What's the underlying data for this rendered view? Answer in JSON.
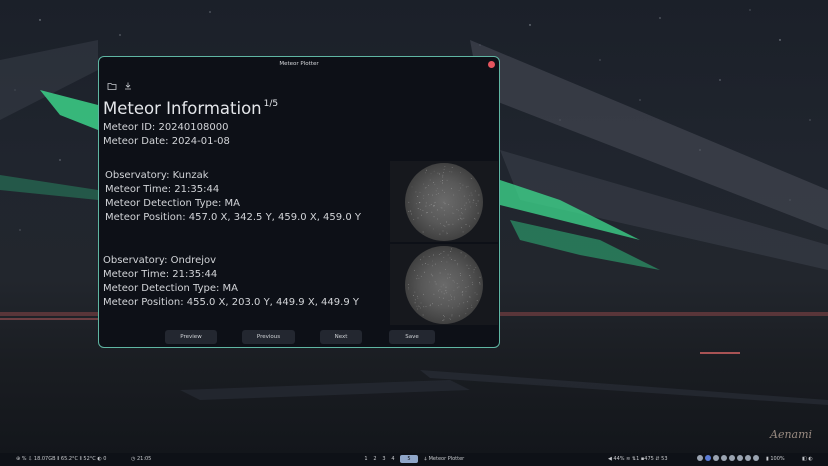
{
  "window": {
    "title": "Meteor Plotter",
    "heading": "Meteor Information",
    "page_indicator": "1/5",
    "meteor_id": "Meteor ID: 20240108000",
    "meteor_date": "Meteor Date: 2024-01-08"
  },
  "observations": [
    {
      "observatory": "Observatory: Kunzak",
      "time": "Meteor Time: 21:35:44",
      "detection_type": "Meteor Detection Type: MA",
      "position": "Meteor Position: 457.0 X, 342.5 Y, 459.0 X, 459.0 Y"
    },
    {
      "observatory": "Observatory: Ondrejov",
      "time": "Meteor Time: 21:35:44",
      "detection_type": "Meteor Detection Type: MA",
      "position": "Meteor Position: 455.0 X, 203.0 Y, 449.9 X, 449.9 Y"
    }
  ],
  "buttons": {
    "preview": "Preview Meteor",
    "previous": "Previous Meteor",
    "next": "Next Meteor",
    "save": "Save Meteors"
  },
  "toolbar": {
    "open_icon": "folder-icon",
    "save_icon": "download-icon"
  },
  "taskbar": {
    "system_stats": "⊕ % ⇩ 18.07GB  ⦀ 65.2°C  ⦀ 52°C  ◐ 0",
    "clock": "◷ 21:05",
    "workspaces": [
      "1",
      "2",
      "3",
      "4",
      "5"
    ],
    "active_workspace": "5",
    "active_app": "⍋ Meteor Plotter",
    "network": "◀ 44%  ≋ ⇅1  ▪475  ⇵ 53",
    "battery": "▮ 100%",
    "end": "◧ ◐"
  },
  "wallpaper": {
    "signature": "Aenami"
  },
  "colors": {
    "window_border": "#5fb6a3",
    "window_bg": "#0d1017",
    "close_button": "#e4555e",
    "active_workspace": "#8fa6c9",
    "aurora": "#3ddc8f"
  }
}
